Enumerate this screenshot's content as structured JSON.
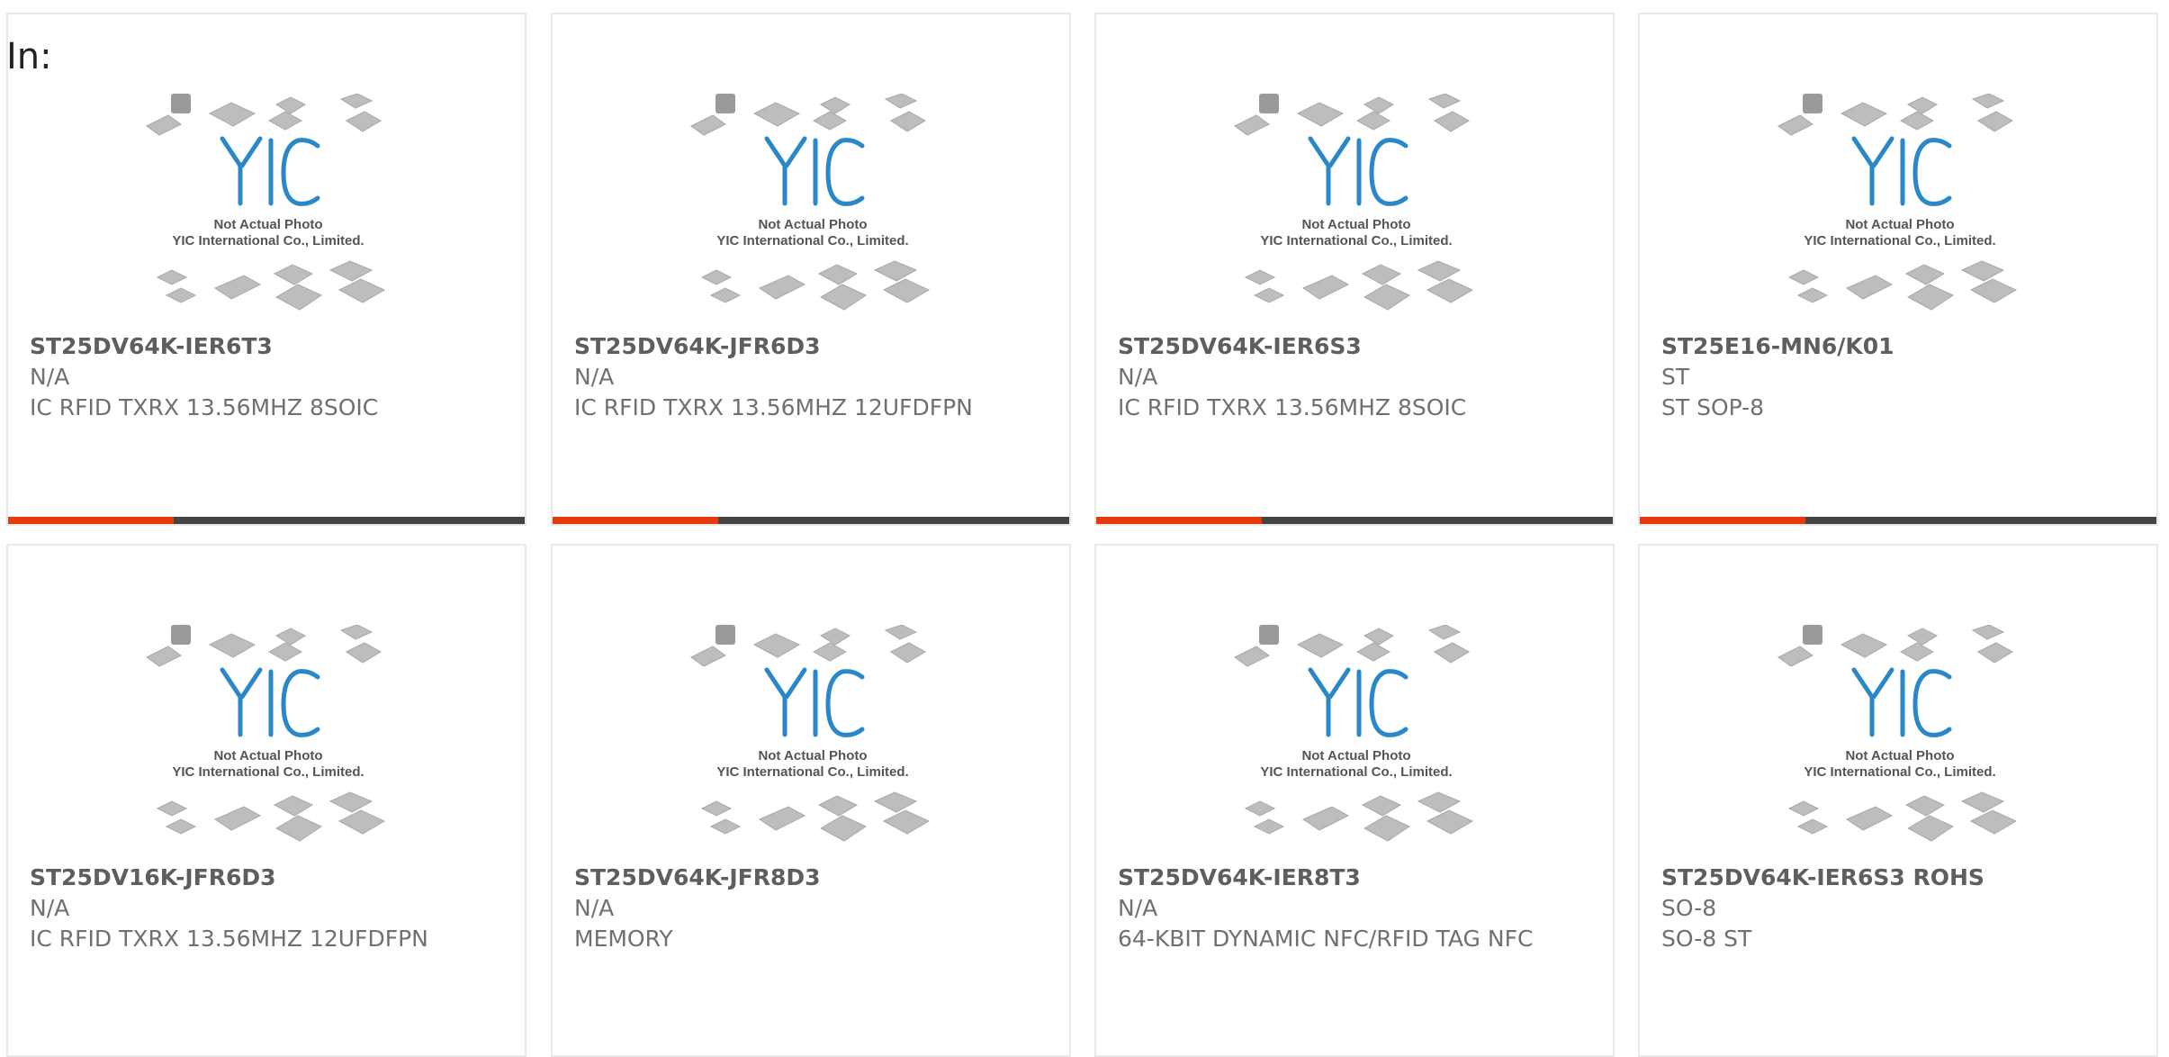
{
  "label": "In:",
  "photo": {
    "caption_line1": "Not Actual Photo",
    "caption_line2": "YIC International Co., Limited.",
    "logo_text": "YIC",
    "logo_color": "#2a88c8"
  },
  "colors": {
    "accent": "#e53b0b",
    "bar": "#444444"
  },
  "products": [
    {
      "part": "ST25DV64K-IER6T3",
      "mfr": "N/A",
      "desc": "IC RFID TXRX 13.56MHZ 8SOIC",
      "bar": true
    },
    {
      "part": "ST25DV64K-JFR6D3",
      "mfr": "N/A",
      "desc": "IC RFID TXRX 13.56MHZ 12UFDFPN",
      "bar": true
    },
    {
      "part": "ST25DV64K-IER6S3",
      "mfr": "N/A",
      "desc": "IC RFID TXRX 13.56MHZ 8SOIC",
      "bar": true
    },
    {
      "part": "ST25E16-MN6/K01",
      "mfr": "ST",
      "desc": "ST SOP-8",
      "bar": true
    },
    {
      "part": "ST25DV16K-JFR6D3",
      "mfr": "N/A",
      "desc": "IC RFID TXRX 13.56MHZ 12UFDFPN",
      "bar": false
    },
    {
      "part": "ST25DV64K-JFR8D3",
      "mfr": "N/A",
      "desc": "MEMORY",
      "bar": false
    },
    {
      "part": "ST25DV64K-IER8T3",
      "mfr": "N/A",
      "desc": "64-KBIT DYNAMIC NFC/RFID TAG NFC",
      "bar": false
    },
    {
      "part": "ST25DV64K-IER6S3 ROHS",
      "mfr": "SO-8",
      "desc": "SO-8 ST",
      "bar": false
    }
  ]
}
